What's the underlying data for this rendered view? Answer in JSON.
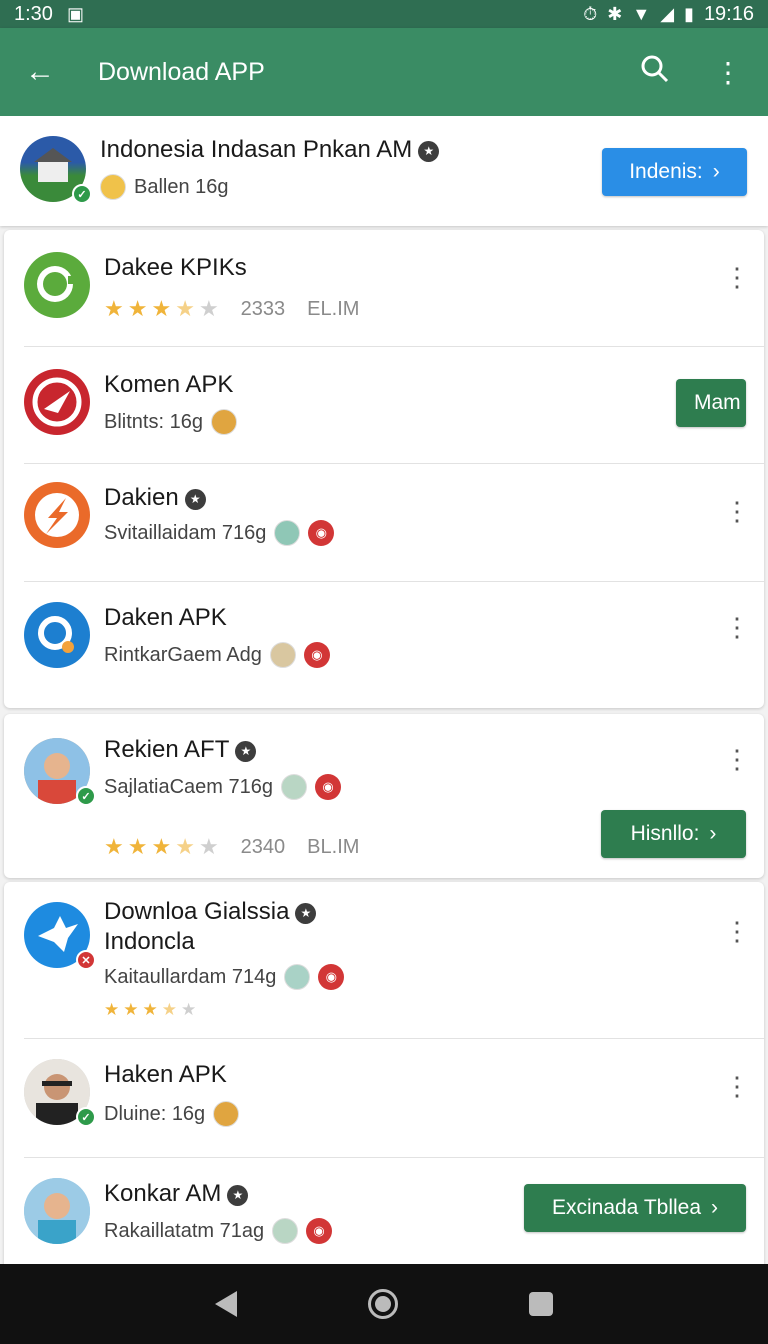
{
  "status": {
    "time_left": "1:30",
    "time_right": "19:16"
  },
  "appbar": {
    "title": "Download APP"
  },
  "featured": {
    "name": "Indonesia Indasan Pnkan AM",
    "sub": "Ballen 16g",
    "button": "Indenis:"
  },
  "items": [
    {
      "name": "Dakee KPIKs",
      "stars": 3.5,
      "count": "2333",
      "size": "EL.IM"
    },
    {
      "name": "Komen APK",
      "sub": "Blitnts: 16g",
      "button": "Mam"
    },
    {
      "name": "Dakien",
      "sub": "Svitaillaidam 716g"
    },
    {
      "name": "Daken APK",
      "sub": "RintkarGaem Adg"
    },
    {
      "name": "Rekien AFT",
      "sub": "SajlatiaCaem 716g",
      "stars": 3.5,
      "count": "2340",
      "size": "BL.IM",
      "button": "Hisnllo:"
    },
    {
      "name": "Downloa Gialssia",
      "name2": "Indoncla",
      "sub": "Kaitaullardam 714g",
      "stars": 3.5
    },
    {
      "name": "Haken APK",
      "sub": "Dluine: 16g"
    },
    {
      "name": "Konkar AM",
      "sub": "Rakaillatatm 71ag",
      "button": "Excinada Tbllea"
    }
  ]
}
